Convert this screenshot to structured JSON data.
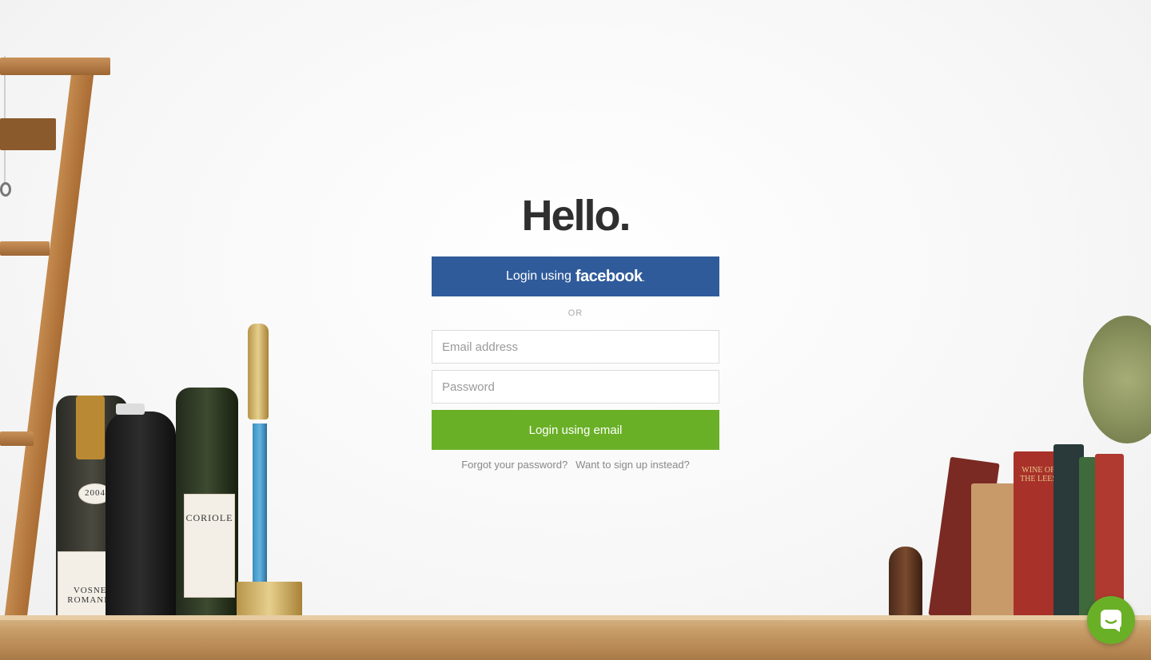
{
  "login": {
    "title": "Hello.",
    "facebook_prefix": "Login using",
    "facebook_word": "facebook",
    "facebook_dot": ".",
    "divider": "OR",
    "email_placeholder": "Email address",
    "password_placeholder": "Password",
    "email_button": "Login using email",
    "forgot_link": "Forgot your password?",
    "signup_link": "Want to sign up instead?"
  },
  "scene": {
    "bottle_labels": [
      "2004",
      "VOSNE-ROMANEE",
      "CORIOLE"
    ],
    "book_titles": [
      "WINE OF THE LEES"
    ]
  },
  "colors": {
    "facebook": "#2f5b9b",
    "email_button": "#6ab027",
    "chat_widget": "#6ab027"
  },
  "chat": {
    "icon": "chat-bubble-icon"
  }
}
